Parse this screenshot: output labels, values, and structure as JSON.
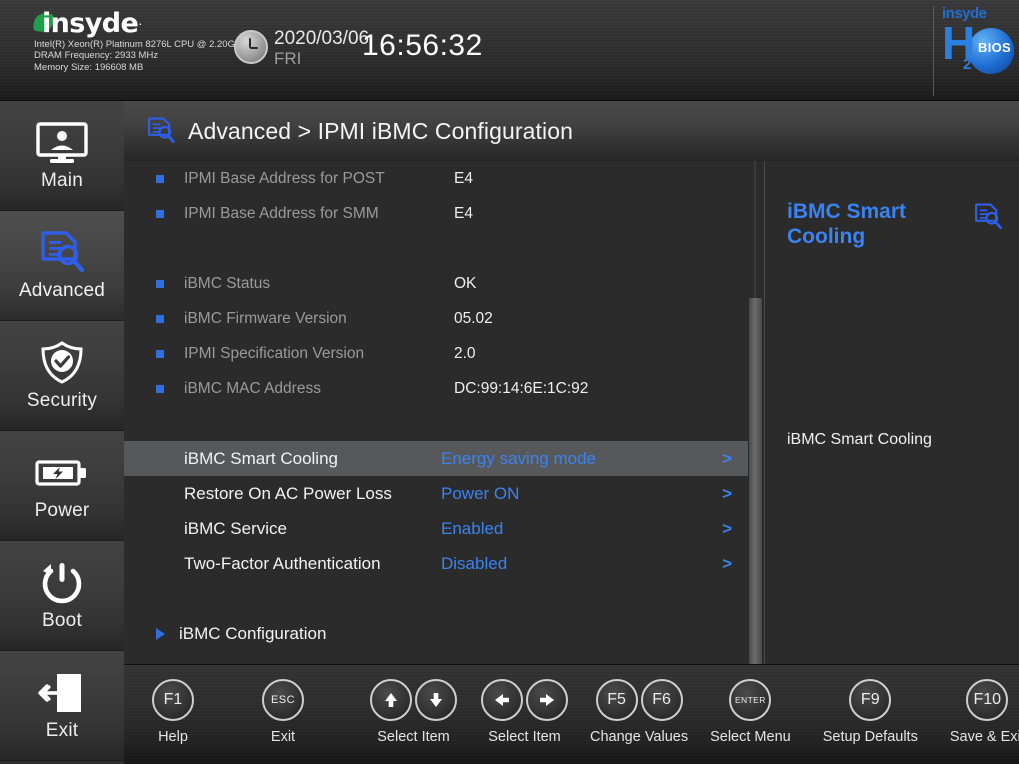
{
  "header": {
    "brand": "insyde",
    "brand_star": "·",
    "sysinfo": "Intel(R) Xeon(R) Platinum 8276L CPU @ 2.20GHz\nDRAM Frequency: 2933 MHz\nMemory Size: 196608 MB",
    "date": "2020/03/06",
    "weekday": "FRI",
    "time": "16:56:32",
    "logo": {
      "top": "insyde",
      "h": "H",
      "sub": "2",
      "o_badge": "BIOS"
    },
    "colors": {
      "accent_green": "#1f9e4b",
      "accent_blue": "#2a7fe0"
    }
  },
  "sidebar": {
    "items": [
      {
        "label": "Main",
        "icon": "monitor-user-icon",
        "active": false
      },
      {
        "label": "Advanced",
        "icon": "document-magnifier-icon",
        "active": true
      },
      {
        "label": "Security",
        "icon": "shield-check-icon",
        "active": false
      },
      {
        "label": "Power",
        "icon": "battery-bolt-icon",
        "active": false
      },
      {
        "label": "Boot",
        "icon": "power-refresh-icon",
        "active": false
      },
      {
        "label": "Exit",
        "icon": "exit-door-arrow-icon",
        "active": false
      }
    ]
  },
  "breadcrumb": {
    "icon": "document-magnifier-icon",
    "text": "Advanced > IPMI iBMC Configuration"
  },
  "main": {
    "info_rows": [
      {
        "label": "IPMI Base Address for POST",
        "value": "E4"
      },
      {
        "label": "IPMI Base Address for SMM",
        "value": "E4"
      },
      {
        "label": "iBMC Status",
        "value": "OK"
      },
      {
        "label": "iBMC Firmware Version",
        "value": "05.02"
      },
      {
        "label": "IPMI Specification Version",
        "value": "2.0"
      },
      {
        "label": "iBMC MAC Address",
        "value": "DC:99:14:6E:1C:92"
      }
    ],
    "option_rows": [
      {
        "label": "iBMC Smart Cooling",
        "value": "Energy saving mode",
        "arrow": ">",
        "selected": true
      },
      {
        "label": "Restore On AC Power Loss",
        "value": "Power ON",
        "arrow": ">",
        "selected": false
      },
      {
        "label": "iBMC Service",
        "value": "Enabled",
        "arrow": ">",
        "selected": false
      },
      {
        "label": "Two-Factor Authentication",
        "value": "Disabled",
        "arrow": ">",
        "selected": false
      }
    ],
    "submenu_rows": [
      {
        "label": "iBMC Configuration",
        "icon": "triangle-right-icon"
      }
    ],
    "value_color": "#3b83f0",
    "selected_row_bg": "#57585a"
  },
  "help": {
    "title": "iBMC Smart Cooling",
    "body": "iBMC Smart Cooling",
    "icon": "document-magnifier-icon",
    "title_color": "#3b83f0"
  },
  "footer": {
    "groups": [
      {
        "keys": [
          "F1"
        ],
        "caption": "Help",
        "key_style": "normal"
      },
      {
        "keys": [
          "ESC"
        ],
        "caption": "Exit",
        "key_style": "small"
      },
      {
        "keys": [
          "arrow-up-icon",
          "arrow-down-icon"
        ],
        "caption": "Select Item",
        "key_style": "icon"
      },
      {
        "keys": [
          "arrow-left-icon",
          "arrow-right-icon"
        ],
        "caption": "Select Item",
        "key_style": "icon"
      },
      {
        "keys": [
          "F5",
          "F6"
        ],
        "caption": "Change Values",
        "key_style": "normal"
      },
      {
        "keys": [
          "ENTER"
        ],
        "caption": "Select Menu",
        "key_style": "tiny"
      },
      {
        "keys": [
          "F9"
        ],
        "caption": "Setup Defaults",
        "key_style": "normal"
      },
      {
        "keys": [
          "F10"
        ],
        "caption": "Save & Exit",
        "key_style": "normal"
      }
    ]
  }
}
